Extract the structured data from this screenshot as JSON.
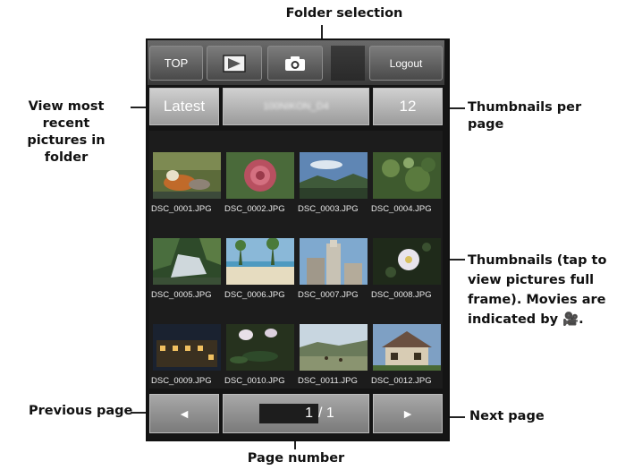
{
  "callouts": {
    "folder_selection": "Folder selection",
    "view_recent_line1": "View most recent",
    "view_recent_line2": "pictures in folder",
    "thumbs_per_page": "Thumbnails per page",
    "thumbnails_line1": "Thumbnails (tap to",
    "thumbnails_line2": "view pictures full",
    "thumbnails_line3": "frame). Movies are",
    "thumbnails_line4": "indicated by 🎥.",
    "previous_page": "Previous page",
    "next_page": "Next page",
    "page_number": "Page number"
  },
  "toolbar": {
    "top_label": "TOP",
    "playback_icon": "playback-icon",
    "camera_icon": "camera-icon",
    "logout_label": "Logout"
  },
  "controls": {
    "latest_label": "Latest",
    "folder_name": "100NIKON_D4",
    "per_page": "12"
  },
  "thumbnails": [
    {
      "name": "DSC_0001.JPG"
    },
    {
      "name": "DSC_0002.JPG"
    },
    {
      "name": "DSC_0003.JPG"
    },
    {
      "name": "DSC_0004.JPG"
    },
    {
      "name": "DSC_0005.JPG"
    },
    {
      "name": "DSC_0006.JPG"
    },
    {
      "name": "DSC_0007.JPG"
    },
    {
      "name": "DSC_0008.JPG"
    },
    {
      "name": "DSC_0009.JPG"
    },
    {
      "name": "DSC_0010.JPG"
    },
    {
      "name": "DSC_0011.JPG"
    },
    {
      "name": "DSC_0012.JPG"
    }
  ],
  "pagination": {
    "prev_icon": "◄",
    "next_icon": "►",
    "current": "1",
    "total": "/ 1"
  }
}
